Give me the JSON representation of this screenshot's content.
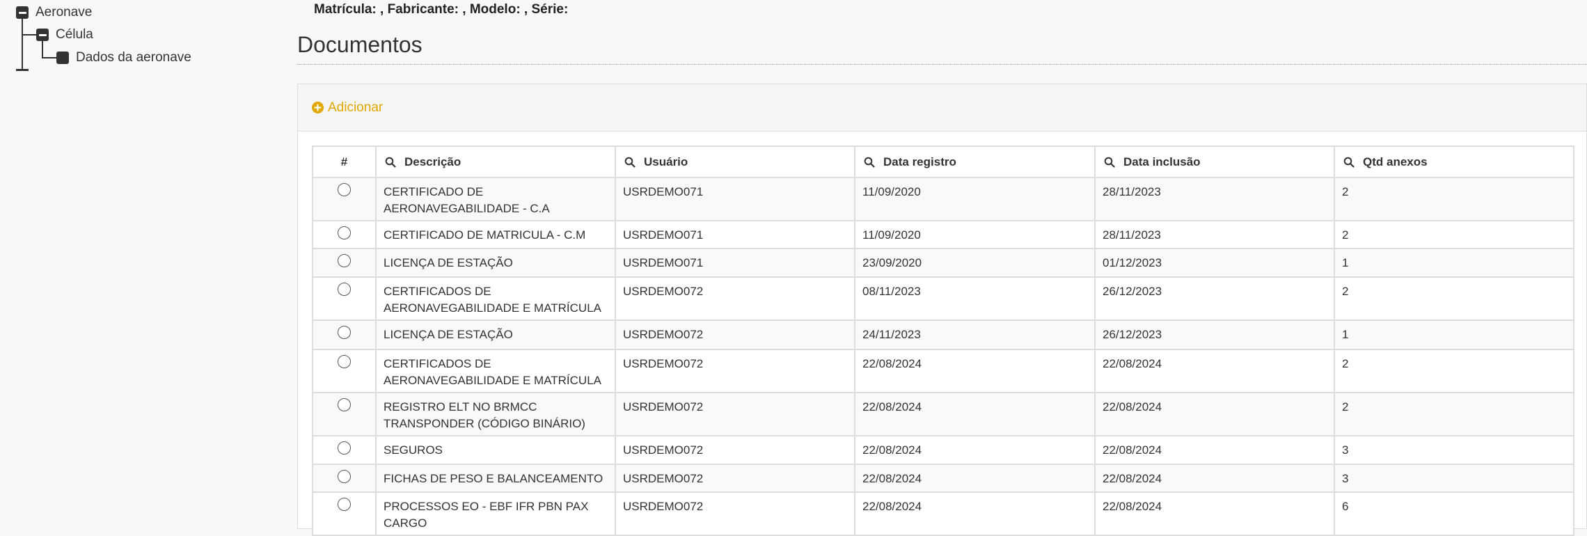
{
  "tree": {
    "root": {
      "label": "Aeronave"
    },
    "child": {
      "label": "Célula"
    },
    "leaf": {
      "label": "Dados da aeronave"
    }
  },
  "header": {
    "aircraft_info": "Matrícula: , Fabricante: , Modelo: , Série:"
  },
  "page": {
    "title": "Documentos"
  },
  "panel": {
    "add_label": "Adicionar"
  },
  "colors": {
    "accent": "#e0a800",
    "text": "#333333",
    "border": "#dddddd"
  },
  "table": {
    "columns": {
      "num": "#",
      "descricao": "Descrição",
      "usuario": "Usuário",
      "data_registro": "Data registro",
      "data_inclusao": "Data inclusão",
      "qtd_anexos": "Qtd anexos"
    },
    "rows": [
      {
        "descricao": "CERTIFICADO DE AERONAVEGABILIDADE - C.A",
        "usuario": "USRDEMO071",
        "data_registro": "11/09/2020",
        "data_inclusao": "28/11/2023",
        "qtd_anexos": "2"
      },
      {
        "descricao": "CERTIFICADO DE MATRICULA - C.M",
        "usuario": "USRDEMO071",
        "data_registro": "11/09/2020",
        "data_inclusao": "28/11/2023",
        "qtd_anexos": "2"
      },
      {
        "descricao": "LICENÇA DE ESTAÇÃO",
        "usuario": "USRDEMO071",
        "data_registro": "23/09/2020",
        "data_inclusao": "01/12/2023",
        "qtd_anexos": "1"
      },
      {
        "descricao": "CERTIFICADOS DE AERONAVEGABILIDADE E MATRÍCULA",
        "usuario": "USRDEMO072",
        "data_registro": "08/11/2023",
        "data_inclusao": "26/12/2023",
        "qtd_anexos": "2"
      },
      {
        "descricao": "LICENÇA DE ESTAÇÃO",
        "usuario": "USRDEMO072",
        "data_registro": "24/11/2023",
        "data_inclusao": "26/12/2023",
        "qtd_anexos": "1"
      },
      {
        "descricao": "CERTIFICADOS DE AERONAVEGABILIDADE E MATRÍCULA",
        "usuario": "USRDEMO072",
        "data_registro": "22/08/2024",
        "data_inclusao": "22/08/2024",
        "qtd_anexos": "2"
      },
      {
        "descricao": "REGISTRO ELT NO BRMCC TRANSPONDER (CÓDIGO BINÁRIO)",
        "usuario": "USRDEMO072",
        "data_registro": "22/08/2024",
        "data_inclusao": "22/08/2024",
        "qtd_anexos": "2"
      },
      {
        "descricao": "SEGUROS",
        "usuario": "USRDEMO072",
        "data_registro": "22/08/2024",
        "data_inclusao": "22/08/2024",
        "qtd_anexos": "3"
      },
      {
        "descricao": "FICHAS DE PESO E BALANCEAMENTO",
        "usuario": "USRDEMO072",
        "data_registro": "22/08/2024",
        "data_inclusao": "22/08/2024",
        "qtd_anexos": "3"
      },
      {
        "descricao": "PROCESSOS EO - EBF IFR PBN PAX CARGO",
        "usuario": "USRDEMO072",
        "data_registro": "22/08/2024",
        "data_inclusao": "22/08/2024",
        "qtd_anexos": "6"
      }
    ]
  }
}
